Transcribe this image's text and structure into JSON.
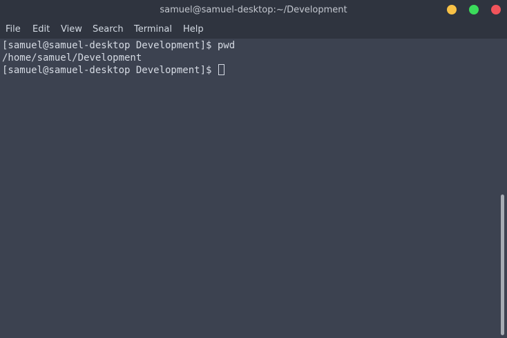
{
  "window": {
    "title": "samuel@samuel-desktop:~/Development",
    "buttons": {
      "minimize_color": "#f8c146",
      "maximize_color": "#3bdb5b",
      "close_color": "#f2545b"
    }
  },
  "menu": {
    "items": [
      {
        "label": "File"
      },
      {
        "label": "Edit"
      },
      {
        "label": "View"
      },
      {
        "label": "Search"
      },
      {
        "label": "Terminal"
      },
      {
        "label": "Help"
      }
    ]
  },
  "terminal": {
    "lines": [
      "[samuel@samuel-desktop Development]$ pwd",
      "/home/samuel/Development",
      "[samuel@samuel-desktop Development]$ "
    ],
    "cursor": "block"
  },
  "scrollbar": {
    "position_fraction": 1.0,
    "visible_fraction": 0.48
  }
}
